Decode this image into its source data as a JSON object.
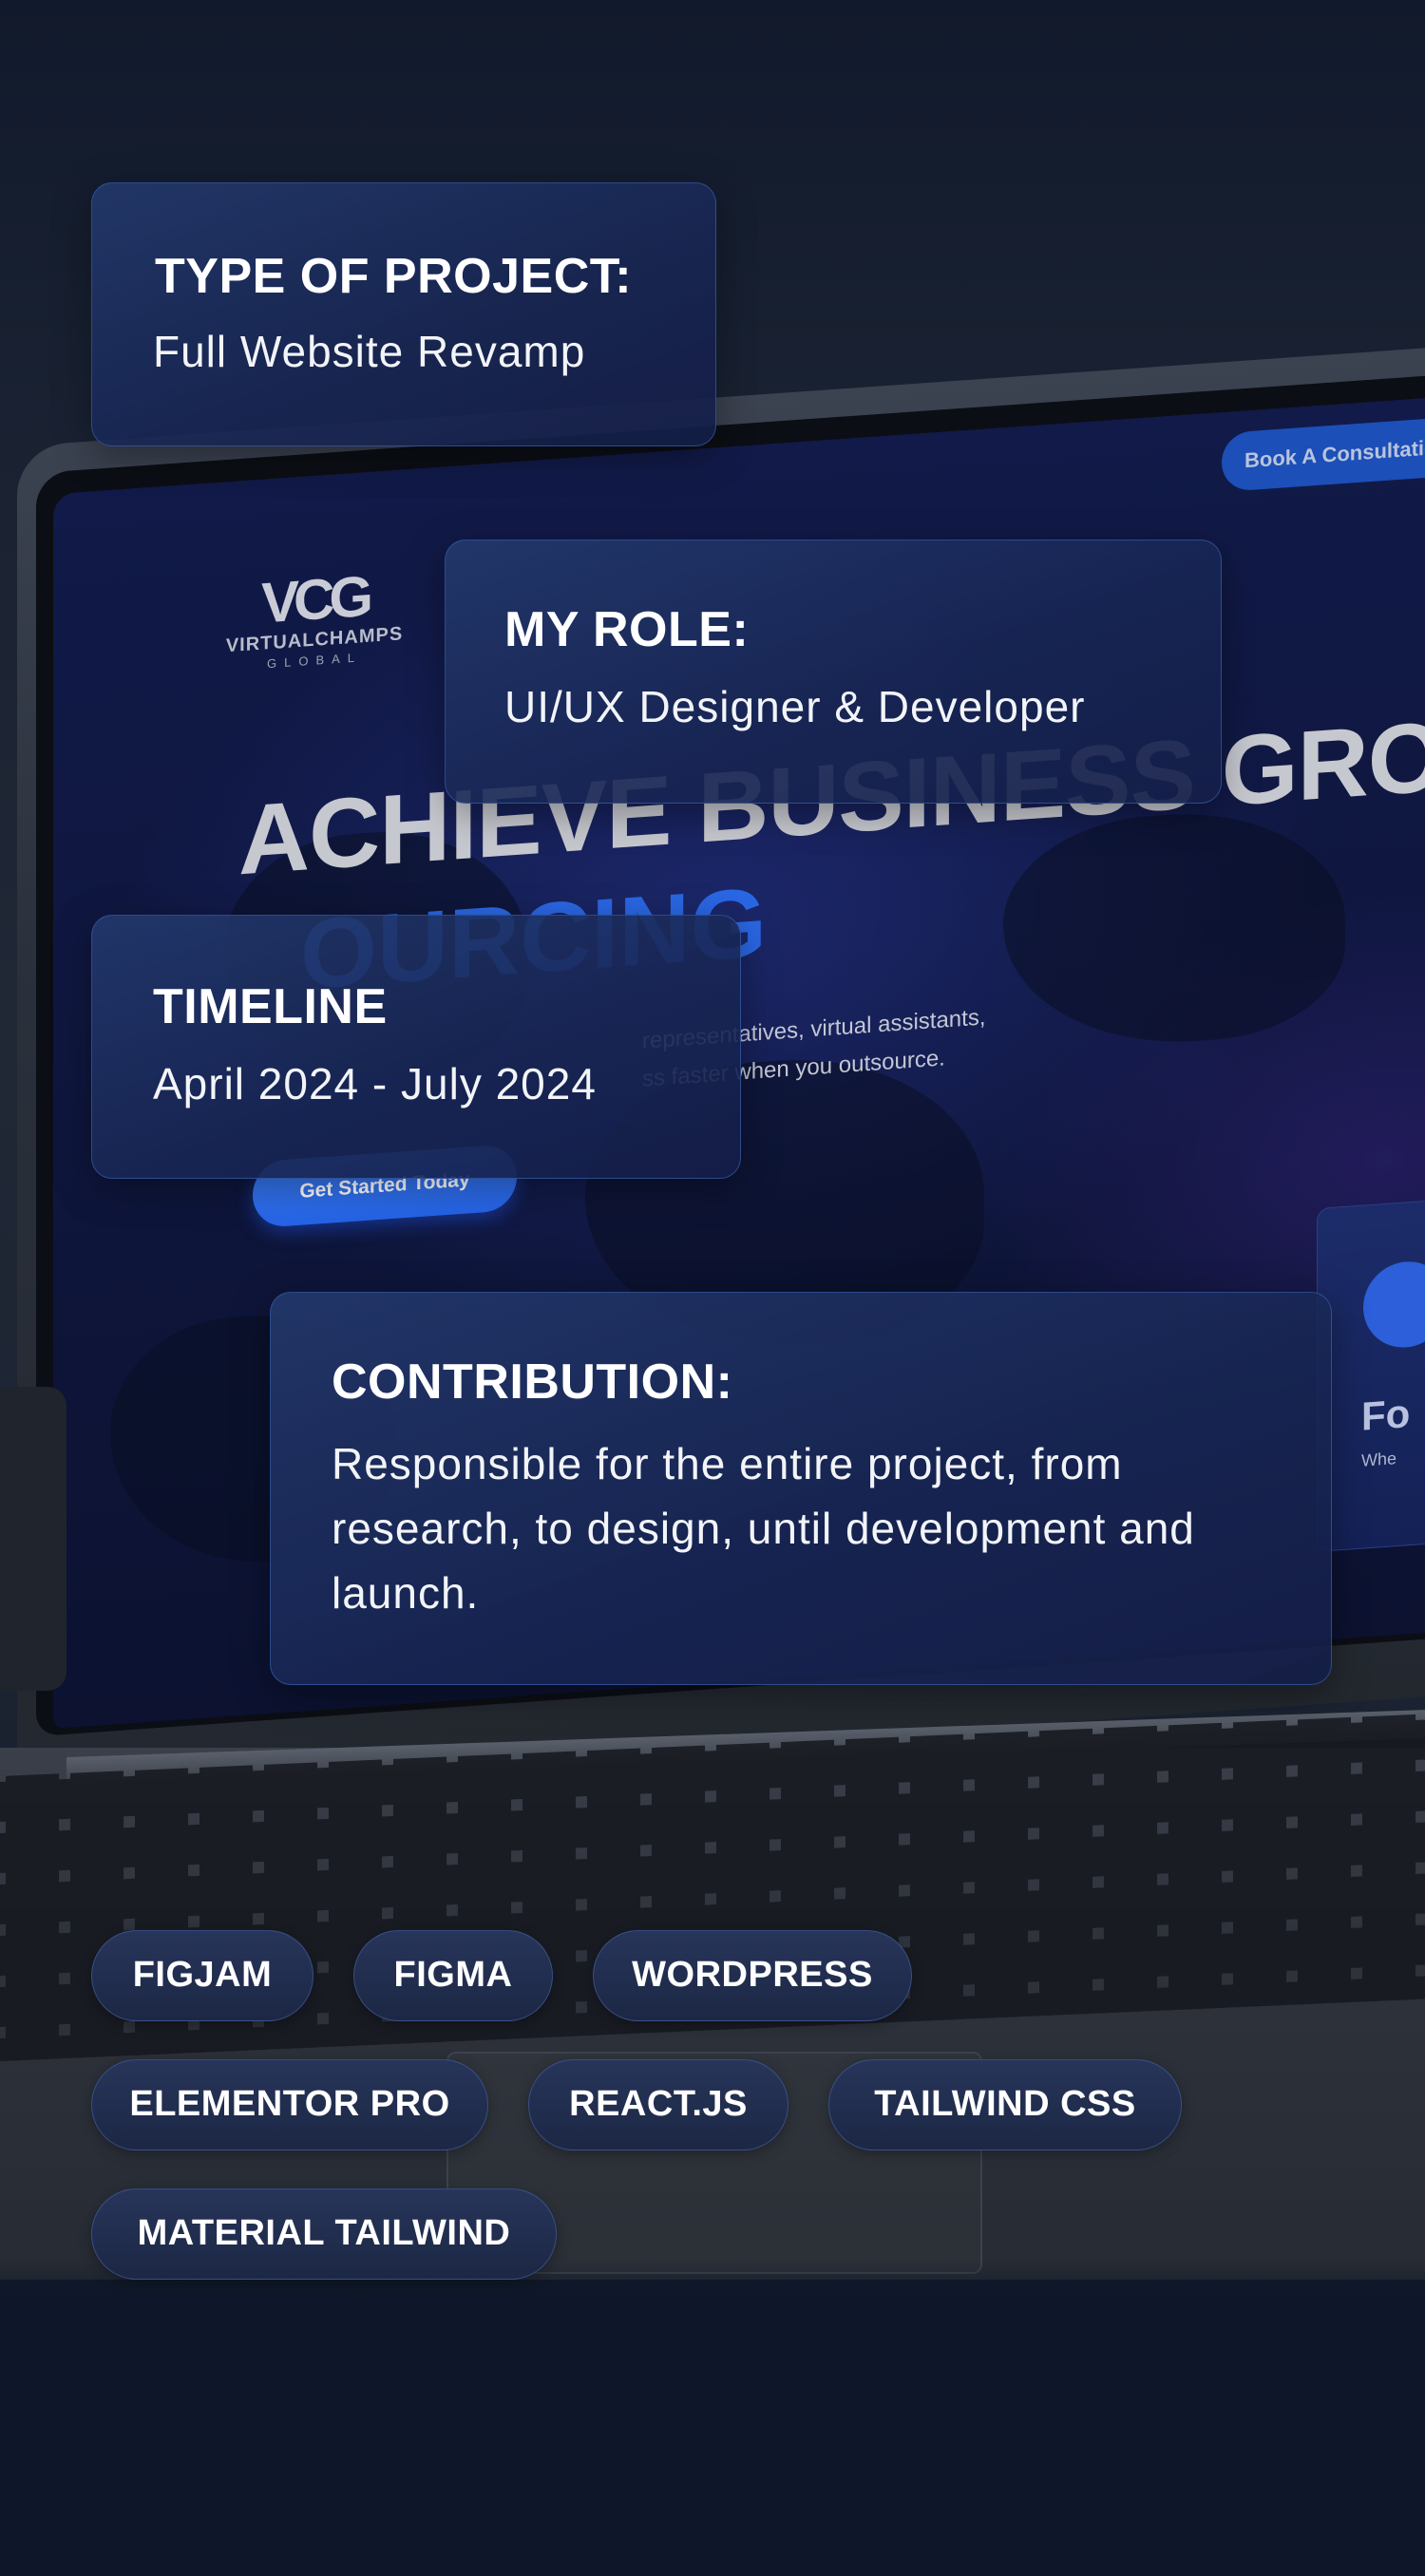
{
  "mockup": {
    "logo_mark": "VCG",
    "logo_name": "VIRTUALCHAMPS",
    "logo_sub": "GLOBAL",
    "book_button": "Book A Consultation",
    "headline_line1": "ACHIEVE BUSINESS GROWTH",
    "headline_line2": "OURCING",
    "subcopy_line1": "representatives, virtual assistants,",
    "subcopy_line2": "ss faster when you outsource.",
    "cta_button": "Get Started Today",
    "side_card_title": "Fo",
    "side_card_text": "Whe"
  },
  "cards": {
    "type": {
      "label": "TYPE OF PROJECT:",
      "value": "Full Website Revamp"
    },
    "role": {
      "label": "MY ROLE:",
      "value": "UI/UX Designer & Developer"
    },
    "timeline": {
      "label": "TIMELINE",
      "value": "April 2024 - July 2024"
    },
    "contribution": {
      "label": "CONTRIBUTION:",
      "value": "Responsible for the entire project, from research, to design, until development and launch."
    }
  },
  "tags": [
    "FIGJAM",
    "FIGMA",
    "WORDPRESS",
    "ELEMENTOR PRO",
    "REACT.JS",
    "TAILWIND CSS",
    "MATERIAL TAILWIND"
  ],
  "colors": {
    "background": "#0e172a",
    "card": "#1c2a5a",
    "accent": "#2a67e4",
    "tag": "#223050"
  }
}
